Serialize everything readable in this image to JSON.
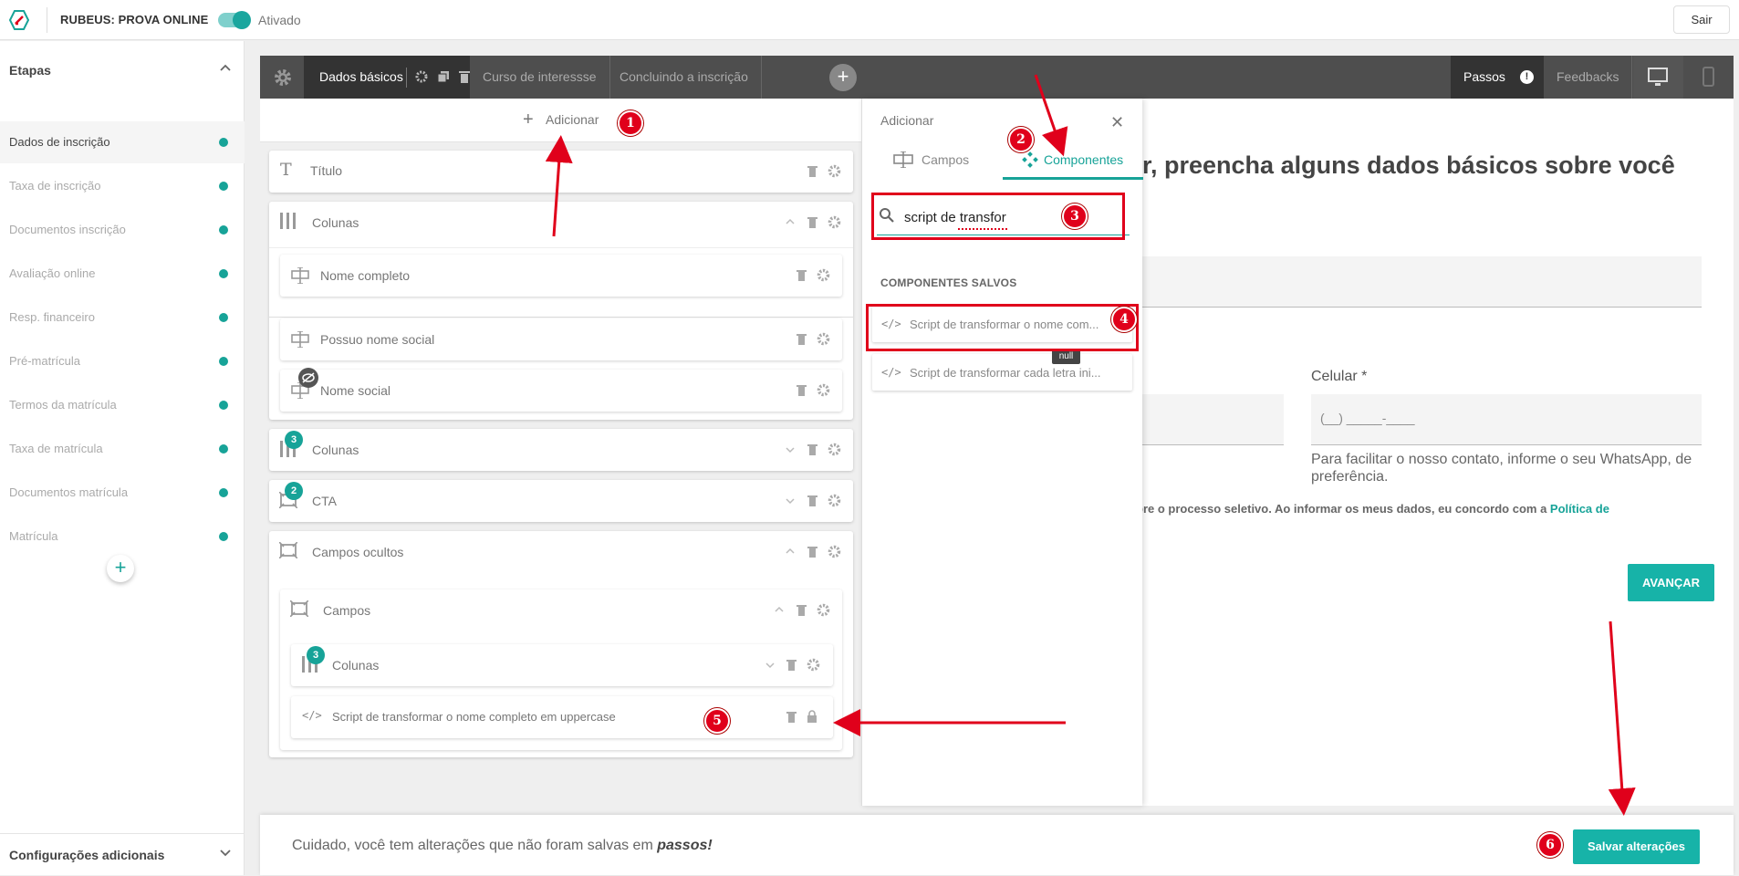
{
  "topbar": {
    "title": "RUBEUS: PROVA ONLINE",
    "toggle_label": "Ativado",
    "logout": "Sair",
    "logo_icon": "rubeus-logo-icon"
  },
  "sidebar": {
    "heading": "Etapas",
    "items": [
      {
        "label": "Dados de inscrição"
      },
      {
        "label": "Taxa de inscrição"
      },
      {
        "label": "Documentos inscrição"
      },
      {
        "label": "Avaliação online"
      },
      {
        "label": "Resp. financeiro"
      },
      {
        "label": "Pré-matrícula"
      },
      {
        "label": "Termos da matrícula"
      },
      {
        "label": "Taxa de matrícula"
      },
      {
        "label": "Documentos matrícula"
      },
      {
        "label": "Matrícula"
      }
    ],
    "add_label": "+",
    "footer": "Configurações adicionais"
  },
  "builder": {
    "tabs": [
      "Dados básicos",
      "Curso de interessse",
      "Concluindo a inscrição"
    ],
    "right_tabs": {
      "passos": "Passos",
      "feedbacks": "Feedbacks"
    },
    "add": "Adicionar",
    "blocks": {
      "titulo": "Título",
      "colunas1": "Colunas",
      "nome_completo": "Nome completo",
      "possuo_nome_social": "Possuo nome social",
      "nome_social": "Nome social",
      "colunas2": "Colunas",
      "colunas2_badge": "3",
      "cta": "CTA",
      "cta_badge": "2",
      "campos_ocultos": "Campos ocultos",
      "campos": "Campos",
      "colunas3": "Colunas",
      "colunas3_badge": "3",
      "script": "Script de transformar o nome completo em uppercase"
    }
  },
  "drawer": {
    "title": "Adicionar",
    "tab_campos": "Campos",
    "tab_componentes": "Componentes",
    "search_value": "script de transfor",
    "saved_heading": "COMPONENTES SALVOS",
    "results": [
      "Script de transformar o nome com...",
      "Script de transformar cada letra ini..."
    ],
    "tooltip": "null"
  },
  "preview": {
    "title_partial": "r, preencha alguns dados básicos sobre você",
    "cel_label": "Celular *",
    "cel_placeholder": "(__) _____-____",
    "cel_help": "Para facilitar o nosso contato, informe o seu WhatsApp, de preferência.",
    "terms": "bre o processo seletivo. Ao informar os meus dados, eu concordo com a",
    "terms_link": "Política de",
    "advance": "AVANÇAR"
  },
  "savebar": {
    "message": "Cuidado, você tem alterações que não foram salvas em",
    "message_emph": "passos!",
    "button": "Salvar alterações"
  },
  "annotations": [
    "1",
    "2",
    "3",
    "4",
    "5",
    "6"
  ],
  "colors": {
    "accent": "#17a398",
    "annotation": "#e0001b",
    "header": "#4e4e4e"
  }
}
